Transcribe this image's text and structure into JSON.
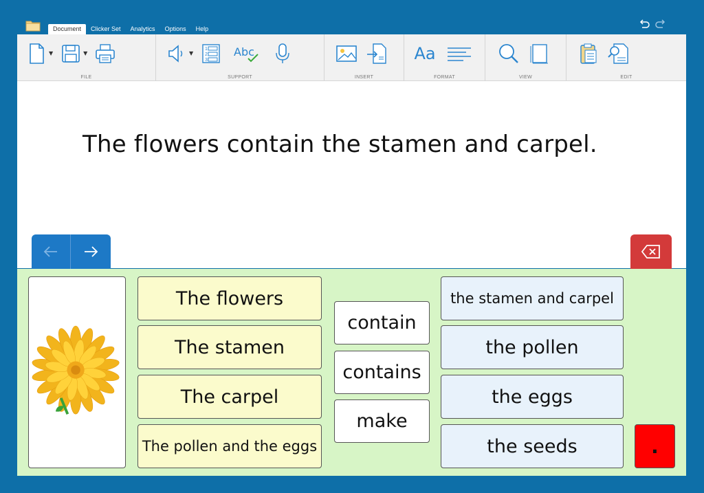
{
  "menu": {
    "tabs": [
      {
        "label": "Document",
        "active": true
      },
      {
        "label": "Clicker Set",
        "active": false
      },
      {
        "label": "Analytics",
        "active": false
      },
      {
        "label": "Options",
        "active": false
      },
      {
        "label": "Help",
        "active": false
      }
    ]
  },
  "ribbon": {
    "groups": {
      "file": "FILE",
      "support": "SUPPORT",
      "insert": "INSERT",
      "format": "FORMAT",
      "view": "VIEW",
      "edit": "EDIT"
    },
    "spellcheck_label": "Abc",
    "font_label": "Aa"
  },
  "document": {
    "text": "The flowers contain the stamen and carpel."
  },
  "grid": {
    "picture": {
      "icon": "sunflower-image"
    },
    "subjects": [
      "The flowers",
      "The stamen",
      "The carpel",
      "The pollen and the eggs"
    ],
    "verbs": [
      "contain",
      "contains",
      "make"
    ],
    "objects": [
      "the stamen and carpel",
      "the pollen",
      "the eggs",
      "the seeds"
    ],
    "full_stop": "."
  },
  "colors": {
    "background": "#0e6fa8",
    "grid_background": "#d7f5c6",
    "subject_cell": "#fbfbcc",
    "object_cell": "#e8f2fb",
    "nav": "#1d79c6",
    "backspace": "#d33a3a",
    "full_stop_cell": "#ff0000",
    "icon_blue": "#2a85cf"
  }
}
